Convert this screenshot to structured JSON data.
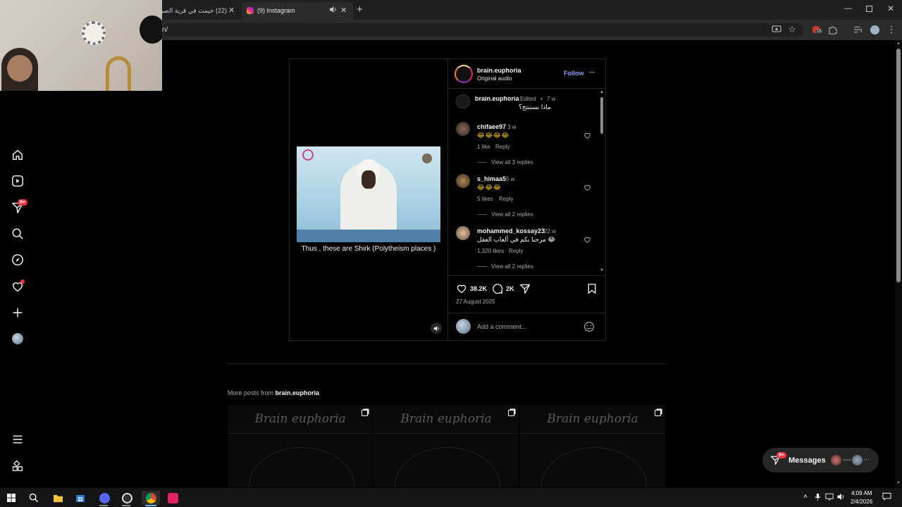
{
  "browser": {
    "tabs": [
      {
        "title": "(22) خيمت في قرية الصياد"
      },
      {
        "title": "(9) Instagram"
      }
    ],
    "url_fragment": "n/"
  },
  "post": {
    "username": "brain.euphoria",
    "audio": "Original audio",
    "follow_label": "Follow",
    "video_caption": "Thus , these are Shirk (Polytheism places )",
    "caption": {
      "username": "brain.euphoria",
      "edited": "Edited",
      "dot": "•",
      "time": "7 w",
      "text": "ماذا نستنتج؟"
    },
    "comments": [
      {
        "username": "chifaee97",
        "time": "3 w",
        "text": "😂😂😂😂",
        "likes": "1 like",
        "reply": "Reply",
        "view_replies": "View all 3 replies"
      },
      {
        "username": "s_himaa5",
        "time": "5 w",
        "text": "😂😂😂",
        "likes": "5 likes",
        "reply": "Reply",
        "view_replies": "View all 2 replies"
      },
      {
        "username": "mohammed_kossay23",
        "time": "22 w",
        "text": "مرحبا بكم في ألعاب العقل 😂",
        "likes": "1,320 likes",
        "reply": "Reply",
        "view_replies": "View all 2 replies"
      }
    ],
    "like_count": "38.2K",
    "comment_count": "2K",
    "date": "27 August 2025",
    "add_comment_placeholder": "Add a comment..."
  },
  "more_posts": {
    "prefix": "More posts from ",
    "username": "brain.euphoria",
    "tiles": [
      {
        "title": "Brain euphoria"
      },
      {
        "title": "Brain euphoria"
      },
      {
        "title": "Brain euphoria"
      }
    ]
  },
  "nav": {
    "notification_badge": "9+"
  },
  "messages": {
    "label": "Messages",
    "badge": "9+"
  },
  "taskbar": {
    "time": "4:09 AM",
    "date": "2/4/2026",
    "extension_badge": "15"
  },
  "colors": {
    "accent": "#0095f6",
    "follow": "#85a1ff",
    "badge": "#ff3040"
  }
}
